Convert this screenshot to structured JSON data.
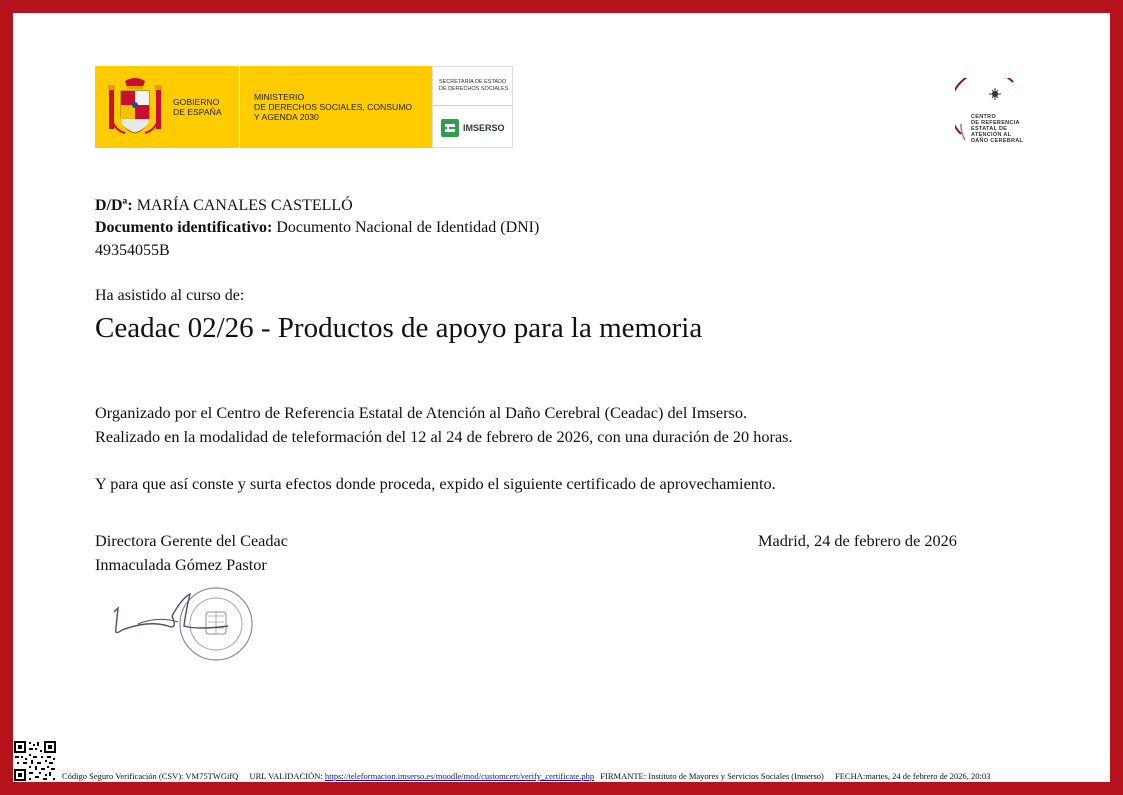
{
  "header": {
    "gobierno": "GOBIERNO\nDE ESPAÑA",
    "ministerio": "MINISTERIO\nDE DERECHOS SOCIALES, CONSUMO\nY AGENDA 2030",
    "secretaria": "SECRETARÍA DE ESTADO\nDE DERECHOS SOCIALES",
    "imserso": "IMSERSO",
    "ceadac": "CENTRO\nDE REFERENCIA\nESTATAL    DE\nATENCIÓN    AL\nDAÑO CEREBRAL"
  },
  "recipient": {
    "name_label": "D/Dª:",
    "name": "MARÍA CANALES CASTELLÓ",
    "doc_label": "Documento identificativo:",
    "doc_type": "Documento Nacional de Identidad (DNI)",
    "doc_number": "49354055B"
  },
  "course": {
    "intro": "Ha asistido al curso de:",
    "title": "Ceadac 02/26 - Productos de apoyo para la memoria"
  },
  "body": {
    "organized": "Organizado por el Centro de Referencia Estatal de Atención al Daño Cerebral (Ceadac) del Imserso.",
    "realized": "Realizado en la modalidad de teleformación del 12 al 24 de febrero de 2026, con una duración de 20 horas.",
    "conste": "Y para que así conste y surta efectos donde proceda, expido el siguiente certificado de aprovechamiento."
  },
  "signatory": {
    "role": "Directora Gerente del Ceadac",
    "name": "Inmaculada Gómez Pastor",
    "place_date": "Madrid, 24 de febrero de 2026"
  },
  "footer": {
    "csv_label": "Código Seguro Verificación (CSV):",
    "csv_value": "VM75TWGifQ",
    "url_label": "URL VALIDACIÓN:",
    "url": "https://teleformacion.imserso.es/moodle/mod/customcert/verify_certificate.php",
    "firmante_label": "FIRMANTE:",
    "firmante": "Instituto de Mayores y Servicios Sociales (Imserso)",
    "fecha_label": "FECHA:",
    "fecha": "martes, 24 de febrero de 2026, 20:03"
  },
  "colors": {
    "frame": "#b5121b",
    "gov_yellow": "#ffcc00",
    "imserso_green": "#2e9e4f"
  }
}
